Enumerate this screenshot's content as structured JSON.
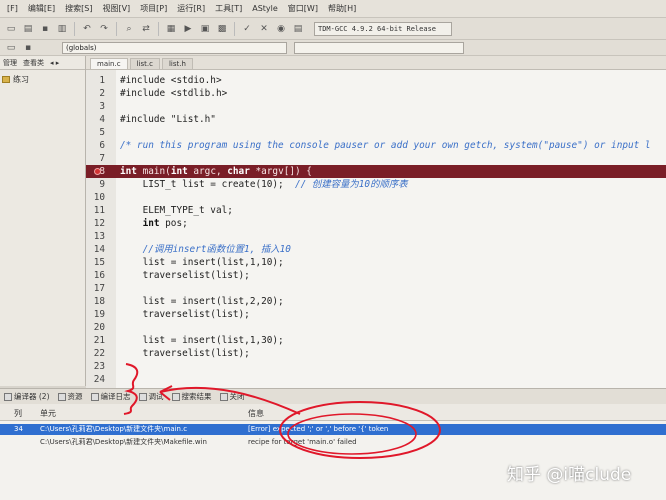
{
  "menubar": {
    "items": [
      "[F]",
      "编辑[E]",
      "搜索[S]",
      "视图[V]",
      "项目[P]",
      "运行[R]",
      "工具[T]",
      "AStyle",
      "窗口[W]",
      "帮助[H]"
    ]
  },
  "toolbar": {
    "compiler": "TDM-GCC 4.9.2 64-bit Release",
    "scope": "(globals)"
  },
  "left_panel": {
    "tabs": [
      "管理",
      "查看类"
    ],
    "tree_item": "练习"
  },
  "file_tabs": [
    "main.c",
    "list.c",
    "list.h"
  ],
  "editor": {
    "lines": [
      {
        "n": "1",
        "code": "#include <stdio.h>"
      },
      {
        "n": "2",
        "code": "#include <stdlib.h>"
      },
      {
        "n": "3",
        "code": ""
      },
      {
        "n": "4",
        "code": "#include \"List.h\""
      },
      {
        "n": "5",
        "code": ""
      },
      {
        "n": "6",
        "code": "/* run this program using the console pauser or add your own getch, system(\"pause\") or input l"
      },
      {
        "n": "7",
        "code": ""
      },
      {
        "n": "8",
        "code": "int main(int argc, char *argv[]) {"
      },
      {
        "n": "9",
        "code": "    LIST_t list = create(10);  // 创建容量为10的顺序表"
      },
      {
        "n": "10",
        "code": ""
      },
      {
        "n": "11",
        "code": "    ELEM_TYPE_t val;"
      },
      {
        "n": "12",
        "code": "    int pos;"
      },
      {
        "n": "13",
        "code": ""
      },
      {
        "n": "14",
        "code": "    //调用insert函数位置1, 插入10"
      },
      {
        "n": "15",
        "code": "    list = insert(list,1,10);"
      },
      {
        "n": "16",
        "code": "    traverselist(list);"
      },
      {
        "n": "17",
        "code": ""
      },
      {
        "n": "18",
        "code": "    list = insert(list,2,20);"
      },
      {
        "n": "19",
        "code": "    traverselist(list);"
      },
      {
        "n": "20",
        "code": ""
      },
      {
        "n": "21",
        "code": "    list = insert(list,1,30);"
      },
      {
        "n": "22",
        "code": "    traverselist(list);"
      },
      {
        "n": "23",
        "code": ""
      },
      {
        "n": "24",
        "code": ""
      }
    ]
  },
  "bottom_tabs": [
    "编译器 (2)",
    "资源",
    "编译日志",
    "调试",
    "搜索结果",
    "关闭"
  ],
  "messages": {
    "headers": {
      "col": "列",
      "unit": "单元",
      "info": "信息"
    },
    "rows": [
      {
        "line": "34",
        "unit": "C:\\Users\\孔莉君\\Desktop\\新建文件夹\\main.c",
        "info": "[Error] expected ';' or ',' before '{' token"
      },
      {
        "line": "",
        "unit": "C:\\Users\\孔莉君\\Desktop\\新建文件夹\\Makefile.win",
        "info": "recipe for target 'main.o' failed"
      }
    ]
  },
  "watermark": "知乎 @i喵clude",
  "colors": {
    "breakpoint_line": "#7a1e27",
    "comment": "#3b70c8",
    "selected_row": "#2f6fd0",
    "annotation": "#e0182a"
  }
}
